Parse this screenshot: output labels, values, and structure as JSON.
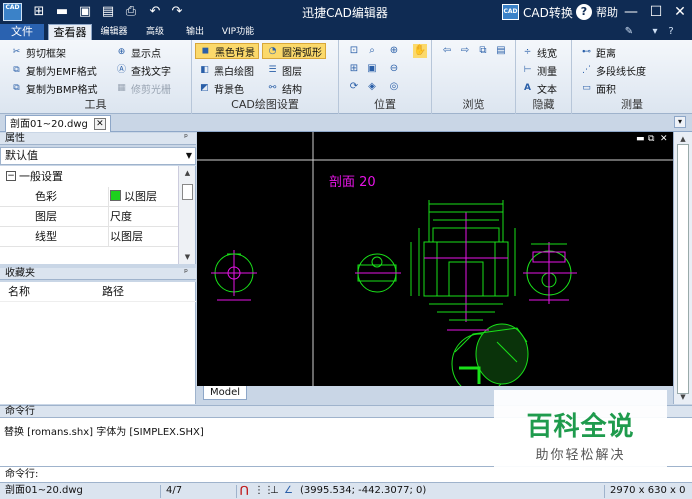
{
  "window": {
    "title": "迅捷CAD编辑器",
    "logo": "CAD",
    "cad_convert": "CAD转换",
    "help": "帮助"
  },
  "tabs": [
    {
      "label": "文件"
    },
    {
      "label": "查看器"
    },
    {
      "label": "编辑器"
    },
    {
      "label": "高级"
    },
    {
      "label": "输出"
    },
    {
      "label": "VIP功能"
    }
  ],
  "ribbon": {
    "tools": {
      "label": "工具",
      "items": [
        "剪切框架",
        "复制为EMF格式",
        "复制为BMP格式",
        "显示点",
        "查找文字",
        "修剪光栅"
      ]
    },
    "cad_settings": {
      "label": "CAD绘图设置",
      "items": [
        "黑色背景",
        "黑白绘图",
        "背景色",
        "圆滑弧形",
        "图层",
        "结构"
      ]
    },
    "position": {
      "label": "位置"
    },
    "browse": {
      "label": "浏览"
    },
    "hide": {
      "label": "隐藏",
      "items": [
        "线宽",
        "测量",
        "文本"
      ]
    },
    "measure": {
      "label": "测量",
      "items": [
        "距离",
        "多段线长度",
        "面积"
      ]
    }
  },
  "document": {
    "tab": "剖面01~20.dwg"
  },
  "properties": {
    "title": "属性",
    "selected": "默认值",
    "group": "一般设置",
    "rows": [
      {
        "key": "色彩",
        "value": "以图层"
      },
      {
        "key": "图层",
        "value": "尺度"
      },
      {
        "key": "线型",
        "value": "以图层"
      }
    ]
  },
  "favorites": {
    "title": "收藏夹",
    "col_name": "名称",
    "col_path": "路径"
  },
  "canvas": {
    "drawing_title": "剖面 20",
    "model_tab": "Model"
  },
  "command": {
    "title": "命令行",
    "output": "替换 [romans.shx] 字体为 [SIMPLEX.SHX]",
    "prompt": "命令行:"
  },
  "watermark": {
    "title": "百科全说",
    "subtitle": "助你轻松解决"
  },
  "statusbar": {
    "file": "剖面01~20.dwg",
    "page": "4/7",
    "coords": "(3995.534; -442.3077; 0)",
    "size": "2970 x 630 x 0 ..."
  },
  "colors": {
    "title_bar": "#0f2b53",
    "drawing_green": "#19e019",
    "drawing_magenta": "#e614e6",
    "watermark_green": "#1f9b4d"
  }
}
